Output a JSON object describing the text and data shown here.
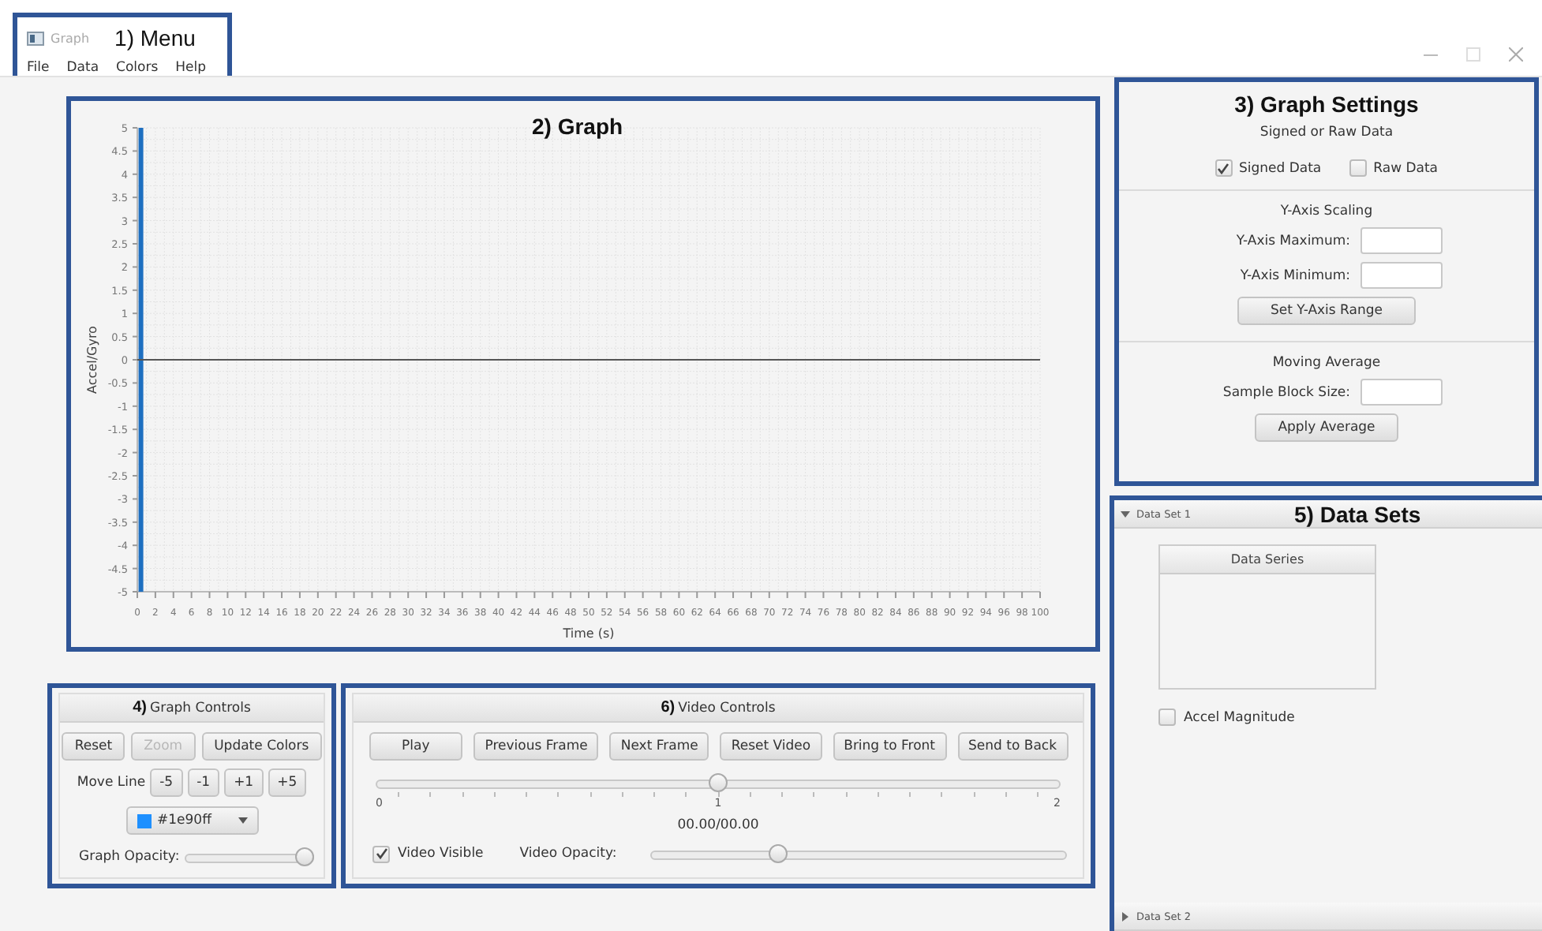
{
  "window": {
    "title": "Graph"
  },
  "menu": {
    "callout": "1) Menu",
    "items": [
      "File",
      "Data",
      "Colors",
      "Help"
    ]
  },
  "graph": {
    "callout": "2) Graph",
    "chart_data": {
      "type": "line",
      "xlabel": "Time (s)",
      "ylabel": "Accel/Gyro",
      "xlim": [
        0,
        100
      ],
      "ylim": [
        -5,
        5
      ],
      "xticks": [
        0,
        2,
        4,
        6,
        8,
        10,
        12,
        14,
        16,
        18,
        20,
        22,
        24,
        26,
        28,
        30,
        32,
        34,
        36,
        38,
        40,
        42,
        44,
        46,
        48,
        50,
        52,
        54,
        56,
        58,
        60,
        62,
        64,
        66,
        68,
        70,
        72,
        74,
        76,
        78,
        80,
        82,
        84,
        86,
        88,
        90,
        92,
        94,
        96,
        98,
        100
      ],
      "yticks": [
        5,
        4.5,
        4,
        3.5,
        3,
        2.5,
        2,
        1.5,
        1,
        0.5,
        0,
        -0.5,
        -1,
        -1.5,
        -2,
        -2.5,
        -3,
        -3.5,
        -4,
        -4.5,
        -5
      ],
      "grid": true,
      "ref_lines": [
        {
          "axis": "x",
          "value": 0.4,
          "color": "#1e6fc0"
        },
        {
          "axis": "y",
          "value": 0,
          "color": "#555555"
        }
      ]
    }
  },
  "graph_settings": {
    "callout": "3) Graph Settings",
    "data_mode": {
      "title": "Signed or Raw Data",
      "options": [
        {
          "label": "Signed Data",
          "checked": true
        },
        {
          "label": "Raw Data",
          "checked": false
        }
      ]
    },
    "y_axis": {
      "title": "Y-Axis Scaling",
      "fields": [
        {
          "label": "Y-Axis Maximum:"
        },
        {
          "label": "Y-Axis Minimum:"
        }
      ],
      "button": "Set Y-Axis Range"
    },
    "moving_average": {
      "title": "Moving Average",
      "field": {
        "label": "Sample Block Size:"
      },
      "button": "Apply Average"
    }
  },
  "graph_controls": {
    "callout": "4)",
    "title": "Graph Controls",
    "buttons": [
      {
        "label": "Reset",
        "disabled": false
      },
      {
        "label": "Zoom",
        "disabled": true
      },
      {
        "label": "Update Colors",
        "disabled": false
      }
    ],
    "move_line": {
      "label": "Move Line",
      "buttons": [
        "-5",
        "-1",
        "+1",
        "+5"
      ]
    },
    "color_picker": {
      "value": "#1e90ff",
      "color": "#1e90ff"
    },
    "opacity": {
      "label": "Graph Opacity:",
      "level": 1
    }
  },
  "data_sets": {
    "callout": "5) Data Sets",
    "sets": [
      {
        "title": "Data Set 1",
        "expanded": true,
        "table_header": "Data Series",
        "option": {
          "label": "Accel Magnitude",
          "checked": false
        }
      },
      {
        "title": "Data Set 2",
        "expanded": false
      }
    ]
  },
  "video_controls": {
    "callout": "6)",
    "title": "Video Controls",
    "buttons": [
      "Play",
      "Previous Frame",
      "Next Frame",
      "Reset Video",
      "Bring to Front",
      "Send to Back"
    ],
    "position": {
      "level": 0.5,
      "ticks": [
        "0",
        "1",
        "2"
      ]
    },
    "time": "00.00/00.00",
    "visible": {
      "label": "Video Visible",
      "checked": true
    },
    "opacity": {
      "label": "Video Opacity:",
      "level": 0.3
    }
  }
}
